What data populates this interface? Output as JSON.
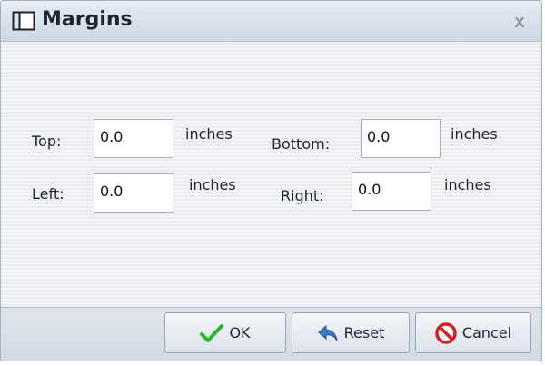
{
  "dialog": {
    "title": "Margins",
    "close_label": "x"
  },
  "fields": {
    "top": {
      "label": "Top:",
      "value": "0.0",
      "unit": "inches"
    },
    "bottom": {
      "label": "Bottom:",
      "value": "0.0",
      "unit": "inches"
    },
    "left": {
      "label": "Left:",
      "value": "0.0",
      "unit": "inches"
    },
    "right": {
      "label": "Right:",
      "value": "0.0",
      "unit": "inches"
    }
  },
  "buttons": {
    "ok": "OK",
    "reset": "Reset",
    "cancel": "Cancel"
  },
  "icons": {
    "title": "document-icon",
    "ok": "checkmark-icon",
    "reset": "undo-arrow-icon",
    "cancel": "no-entry-icon"
  },
  "colors": {
    "ok_icon": "#2bb52b",
    "reset_icon": "#3b78c9",
    "cancel_icon": "#d11f1f"
  }
}
